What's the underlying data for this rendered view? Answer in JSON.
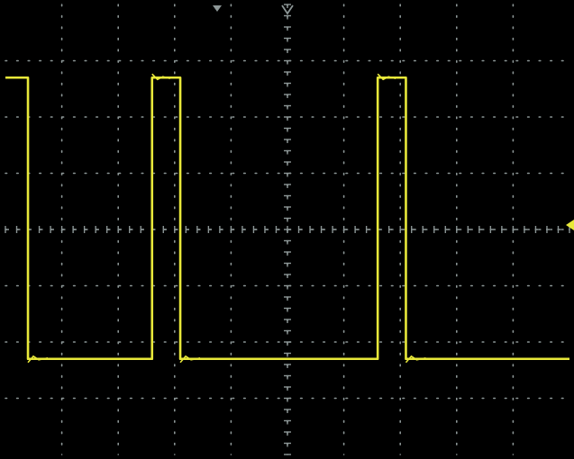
{
  "screen": {
    "background": "#000000",
    "grid_color": "#8c9696",
    "trace_color": "#e8e83a"
  },
  "grid": {
    "horizontal_divisions": 10,
    "vertical_divisions": 8,
    "minor_ticks_per_division": 5,
    "style": "dotted"
  },
  "markers": {
    "trigger_position": "trigger-position-marker",
    "trigger_level": "trigger-level-marker",
    "waveform_reference": "waveform-reference-marker"
  },
  "waveform": {
    "type": "square-pulse-train",
    "high_level_div": 2.7,
    "low_level_div": -2.3,
    "pulses": [
      {
        "rise_div": -5.0,
        "fall_div": -4.6
      },
      {
        "rise_div": -2.4,
        "fall_div": -1.9
      },
      {
        "rise_div": 1.6,
        "fall_div": 2.1
      }
    ],
    "period_div": 4.0,
    "duty_fraction": 0.13
  }
}
